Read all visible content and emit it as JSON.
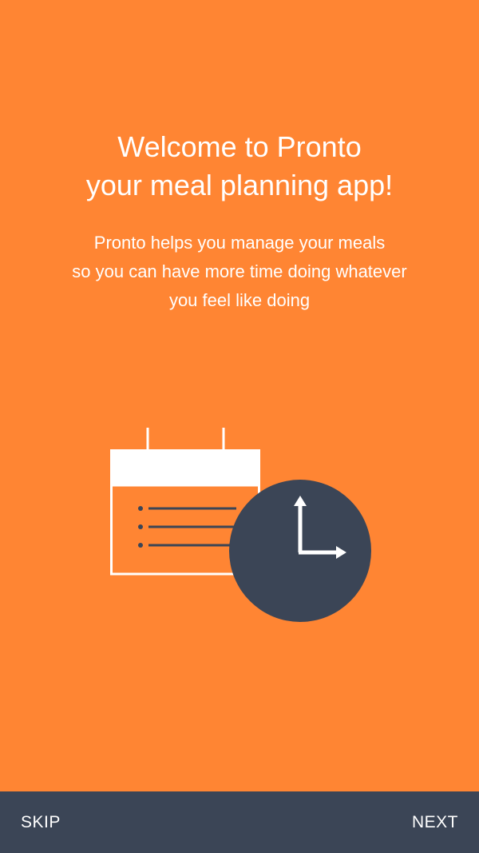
{
  "onboarding": {
    "title_lines": [
      "Welcome to Pronto",
      "your meal planning app!"
    ],
    "description_lines": [
      "Pronto helps you manage your meals",
      "so you can have more time doing whatever",
      "you feel like doing"
    ],
    "illustration_icons": [
      "calendar-icon",
      "clock-icon"
    ]
  },
  "nav": {
    "skip_label": "SKIP",
    "next_label": "NEXT"
  },
  "colors": {
    "background": "#FF8533",
    "bottom_bar": "#3B4556",
    "text": "#FFFFFF",
    "clock_face": "#3B4556"
  }
}
